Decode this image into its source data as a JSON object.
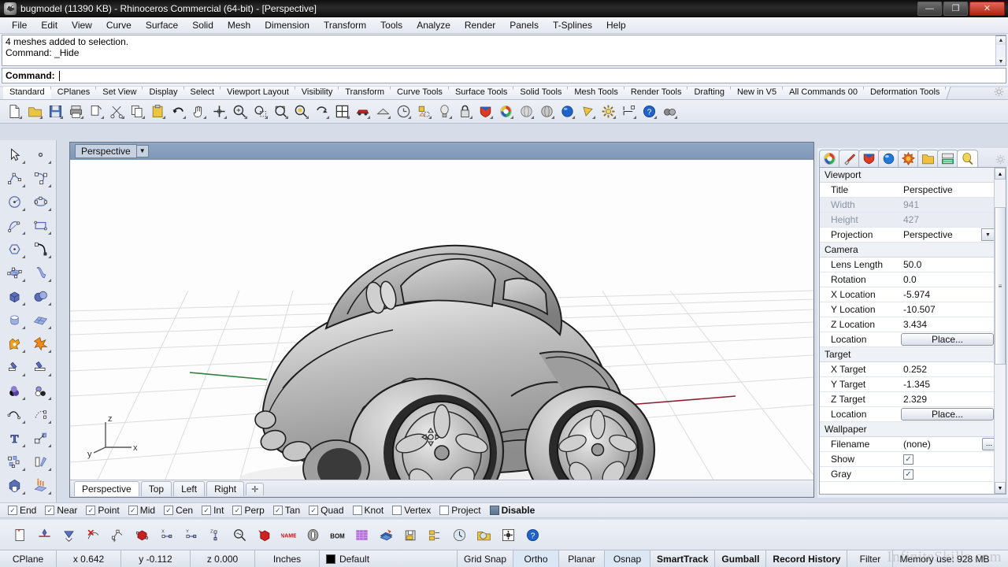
{
  "window": {
    "title": "bugmodel (11390 KB) - Rhinoceros Commercial (64-bit) - [Perspective]",
    "app_icon": "rhino-logo-icon",
    "minimize_label": "—",
    "restore_label": "❐",
    "close_label": "✕"
  },
  "menubar": {
    "items": [
      {
        "label": "File"
      },
      {
        "label": "Edit"
      },
      {
        "label": "View"
      },
      {
        "label": "Curve"
      },
      {
        "label": "Surface"
      },
      {
        "label": "Solid"
      },
      {
        "label": "Mesh"
      },
      {
        "label": "Dimension"
      },
      {
        "label": "Transform"
      },
      {
        "label": "Tools"
      },
      {
        "label": "Analyze"
      },
      {
        "label": "Render"
      },
      {
        "label": "Panels"
      },
      {
        "label": "T-Splines"
      },
      {
        "label": "Help"
      }
    ]
  },
  "command_area": {
    "history": [
      "4 meshes added to selection.",
      "Command: _Hide"
    ],
    "prompt": "Command:",
    "input_value": "",
    "scroll_up_icon": "▲",
    "scroll_down_icon": "▼"
  },
  "toolbar_tabs": {
    "active": "Standard",
    "items": [
      {
        "label": "Standard"
      },
      {
        "label": "CPlanes"
      },
      {
        "label": "Set View"
      },
      {
        "label": "Display"
      },
      {
        "label": "Select"
      },
      {
        "label": "Viewport Layout"
      },
      {
        "label": "Visibility"
      },
      {
        "label": "Transform"
      },
      {
        "label": "Curve Tools"
      },
      {
        "label": "Surface Tools"
      },
      {
        "label": "Solid Tools"
      },
      {
        "label": "Mesh Tools"
      },
      {
        "label": "Render Tools"
      },
      {
        "label": "Drafting"
      },
      {
        "label": "New in V5"
      },
      {
        "label": "All Commands 00"
      },
      {
        "label": "Deformation Tools"
      }
    ],
    "options_icon": "gear-icon"
  },
  "main_toolbar": {
    "buttons": [
      {
        "name": "new-file-icon"
      },
      {
        "name": "open-file-icon"
      },
      {
        "name": "save-file-icon"
      },
      {
        "name": "print-icon"
      },
      {
        "name": "cut-copy-paste-icon"
      },
      {
        "name": "cut-scissors-icon"
      },
      {
        "name": "copy-icon"
      },
      {
        "name": "paste-icon"
      },
      {
        "name": "undo-icon"
      },
      {
        "name": "pan-hand-icon"
      },
      {
        "name": "zoom-dynamic-icon"
      },
      {
        "name": "zoom-in-icon"
      },
      {
        "name": "zoom-window-icon"
      },
      {
        "name": "zoom-extents-icon"
      },
      {
        "name": "zoom-selected-icon"
      },
      {
        "name": "rotate-view-icon"
      },
      {
        "name": "four-viewport-icon"
      },
      {
        "name": "render-car-icon"
      },
      {
        "name": "shaded-view-icon"
      },
      {
        "name": "clock-render-icon"
      },
      {
        "name": "properties-icon"
      },
      {
        "name": "light-bulb-icon"
      },
      {
        "name": "lock-icon"
      },
      {
        "name": "layers-shield-icon"
      },
      {
        "name": "color-wheel-icon"
      },
      {
        "name": "sphere-gray-icon"
      },
      {
        "name": "sphere-gray2-icon"
      },
      {
        "name": "sphere-blue-icon"
      },
      {
        "name": "cone-yellow-icon"
      },
      {
        "name": "options-gear-icon"
      },
      {
        "name": "dimension-icon"
      },
      {
        "name": "help-icon"
      },
      {
        "name": "glasses-icon"
      }
    ]
  },
  "left_toolbar": {
    "buttons": [
      {
        "name": "select-arrow-icon"
      },
      {
        "name": "point-icon"
      },
      {
        "name": "polyline-icon"
      },
      {
        "name": "curve-control-points-icon"
      },
      {
        "name": "circle-icon"
      },
      {
        "name": "ellipse-icon"
      },
      {
        "name": "arc-icon"
      },
      {
        "name": "rectangle-icon"
      },
      {
        "name": "polygon-icon"
      },
      {
        "name": "curve-fillet-icon"
      },
      {
        "name": "surface-control-points-icon"
      },
      {
        "name": "surface-sweep-icon"
      },
      {
        "name": "box-solid-icon"
      },
      {
        "name": "sphere-boolean-icon"
      },
      {
        "name": "cylinder-icon"
      },
      {
        "name": "mesh-plane-icon"
      },
      {
        "name": "boolean-union-icon"
      },
      {
        "name": "explode-icon"
      },
      {
        "name": "trim-icon"
      },
      {
        "name": "split-icon"
      },
      {
        "name": "layers-color-icon"
      },
      {
        "name": "object-properties-icon"
      },
      {
        "name": "curve-tools-icon"
      },
      {
        "name": "curve-from-object-icon"
      },
      {
        "name": "text-tool-icon"
      },
      {
        "name": "transform-scale-icon"
      },
      {
        "name": "array-icon"
      },
      {
        "name": "mirror-icon"
      },
      {
        "name": "solid-edit-icon"
      },
      {
        "name": "extrude-icon"
      }
    ],
    "more_icon": "»"
  },
  "viewport": {
    "name": "Perspective",
    "dropdown_icon": "chevron-down-icon",
    "model": "vw-beetle-cartoon-car",
    "cursor": "pan-move-cursor",
    "axis_labels": {
      "x": "x",
      "y": "y",
      "z": "z"
    },
    "tabs": [
      {
        "label": "Perspective",
        "active": true
      },
      {
        "label": "Top",
        "active": false
      },
      {
        "label": "Left",
        "active": false
      },
      {
        "label": "Right",
        "active": false
      }
    ],
    "add_tab_icon": "✛"
  },
  "properties_panel": {
    "tabs": [
      {
        "name": "properties-color-wheel-tab",
        "active": false
      },
      {
        "name": "layers-brush-tab",
        "active": false
      },
      {
        "name": "display-shield-tab",
        "active": false
      },
      {
        "name": "render-sphere-tab",
        "active": false
      },
      {
        "name": "sun-light-tab",
        "active": false
      },
      {
        "name": "folder-tab",
        "active": false
      },
      {
        "name": "notes-keyboard-tab",
        "active": false
      },
      {
        "name": "lightbulb-tab",
        "active": true
      }
    ],
    "options_icon": "gear-icon",
    "groups": [
      {
        "title": "Viewport",
        "rows": [
          {
            "label": "Title",
            "value": "Perspective",
            "kind": "text",
            "dim": false
          },
          {
            "label": "Width",
            "value": "941",
            "kind": "text",
            "dim": true
          },
          {
            "label": "Height",
            "value": "427",
            "kind": "text",
            "dim": true
          },
          {
            "label": "Projection",
            "value": "Perspective",
            "kind": "combo",
            "dim": false
          }
        ]
      },
      {
        "title": "Camera",
        "rows": [
          {
            "label": "Lens Length",
            "value": "50.0",
            "kind": "text",
            "dim": false
          },
          {
            "label": "Rotation",
            "value": "0.0",
            "kind": "text",
            "dim": false
          },
          {
            "label": "X Location",
            "value": "-5.974",
            "kind": "text",
            "dim": false
          },
          {
            "label": "Y Location",
            "value": "-10.507",
            "kind": "text",
            "dim": false
          },
          {
            "label": "Z Location",
            "value": "3.434",
            "kind": "text",
            "dim": false
          },
          {
            "label": "Location",
            "value": "Place...",
            "kind": "button",
            "dim": false
          }
        ]
      },
      {
        "title": "Target",
        "rows": [
          {
            "label": "X Target",
            "value": "0.252",
            "kind": "text",
            "dim": false
          },
          {
            "label": "Y Target",
            "value": "-1.345",
            "kind": "text",
            "dim": false
          },
          {
            "label": "Z Target",
            "value": "2.329",
            "kind": "text",
            "dim": false
          },
          {
            "label": "Location",
            "value": "Place...",
            "kind": "button",
            "dim": false
          }
        ]
      },
      {
        "title": "Wallpaper",
        "rows": [
          {
            "label": "Filename",
            "value": "(none)",
            "kind": "file",
            "dim": false
          },
          {
            "label": "Show",
            "value": "checked",
            "kind": "check",
            "dim": false
          },
          {
            "label": "Gray",
            "value": "checked",
            "kind": "check",
            "dim": false
          }
        ]
      }
    ],
    "scroll_up_icon": "▲",
    "scroll_down_icon": "▼"
  },
  "osnap_bar": {
    "items": [
      {
        "label": "End",
        "checked": true
      },
      {
        "label": "Near",
        "checked": true
      },
      {
        "label": "Point",
        "checked": true
      },
      {
        "label": "Mid",
        "checked": true
      },
      {
        "label": "Cen",
        "checked": true
      },
      {
        "label": "Int",
        "checked": true
      },
      {
        "label": "Perp",
        "checked": true
      },
      {
        "label": "Tan",
        "checked": true
      },
      {
        "label": "Quad",
        "checked": true
      },
      {
        "label": "Knot",
        "checked": false
      },
      {
        "label": "Vertex",
        "checked": false
      },
      {
        "label": "Project",
        "checked": false
      }
    ],
    "disable": {
      "label": "Disable",
      "filled": true
    },
    "check_glyph": "✓"
  },
  "bottom_toolbar": {
    "buttons": [
      {
        "name": "new-layer-icon"
      },
      {
        "name": "curve-from-points-icon"
      },
      {
        "name": "blend-surface-icon"
      },
      {
        "name": "delete-curve-icon"
      },
      {
        "name": "point-edit-icon"
      },
      {
        "name": "box-edit-icon"
      },
      {
        "name": "move-x-icon"
      },
      {
        "name": "move-y-icon"
      },
      {
        "name": "move-z-icon"
      },
      {
        "name": "zoom-analyze-icon"
      },
      {
        "name": "extract-solid-icon"
      },
      {
        "name": "name-tool-icon"
      },
      {
        "name": "cylinder-analysis-icon"
      },
      {
        "name": "bom-icon"
      },
      {
        "name": "texture-icon"
      },
      {
        "name": "paint-layers-icon"
      },
      {
        "name": "save-block-icon"
      },
      {
        "name": "export-block-icon"
      },
      {
        "name": "timer-icon"
      },
      {
        "name": "open-recent-icon"
      },
      {
        "name": "settings-gear-icon"
      },
      {
        "name": "help-question-icon"
      }
    ]
  },
  "status_bar": {
    "cplane_label": "CPlane",
    "x": "x 0.642",
    "y": "y -0.112",
    "z": "z 0.000",
    "units": "Inches",
    "layer": "Default",
    "layer_color": "#000000",
    "toggles": [
      {
        "label": "Grid Snap",
        "on": false
      },
      {
        "label": "Ortho",
        "on": true
      },
      {
        "label": "Planar",
        "on": false
      },
      {
        "label": "Osnap",
        "on": true
      },
      {
        "label": "SmartTrack",
        "on": false,
        "bold": true
      },
      {
        "label": "Gumball",
        "on": false,
        "bold": true
      },
      {
        "label": "Record History",
        "on": false,
        "bold": true
      },
      {
        "label": "Filter",
        "on": false
      }
    ],
    "memory": "Memory use: 928 MB"
  },
  "watermark": "InfiniteSkills.com"
}
